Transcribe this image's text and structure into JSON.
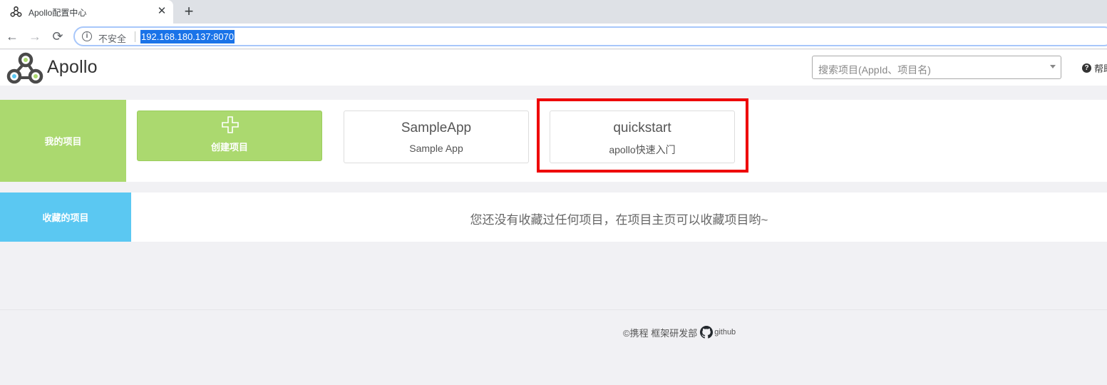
{
  "browser": {
    "tab_title": "Apollo配置中心",
    "close_glyph": "✕",
    "new_tab_glyph": "+",
    "back_glyph": "←",
    "forward_glyph": "→",
    "reload_glyph": "⟳",
    "info_glyph": "i",
    "security_label": "不安全",
    "url": "192.168.180.137:8070"
  },
  "header": {
    "logo_text": "Apollo",
    "search_placeholder": "搜索项目(AppId、项目名)",
    "help_glyph": "?",
    "help_label": "帮助"
  },
  "my_projects": {
    "section_label": "我的项目",
    "create_label": "创建项目",
    "apps": [
      {
        "app_id": "SampleApp",
        "name": "Sample App"
      },
      {
        "app_id": "quickstart",
        "name": "apollo快速入门"
      }
    ]
  },
  "favorites": {
    "section_label": "收藏的项目",
    "empty_message": "您还没有收藏过任何项目，在项目主页可以收藏项目哟~"
  },
  "footer": {
    "copyright": "©携程 框架研发部",
    "github_label": "github"
  },
  "colors": {
    "my_projects_accent": "#abd96f",
    "favorites_accent": "#5bc8f2",
    "highlight": "#ee0000",
    "url_selection": "#1a73e8"
  },
  "icons": {
    "tab_favicon": "apollo-logo-icon",
    "logo": "apollo-logo-icon",
    "create": "plus-icon",
    "help": "question-circle-icon",
    "footer": "github-icon"
  }
}
